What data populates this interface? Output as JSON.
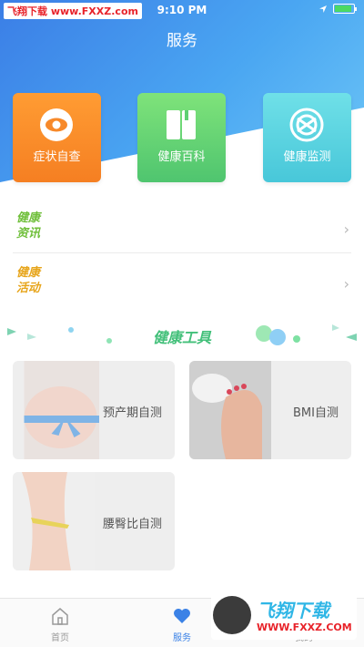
{
  "status_bar": {
    "watermark": "飞翔下载 www.FXXZ.com",
    "time": "9:10 PM"
  },
  "nav": {
    "title": "服务"
  },
  "service_cards": [
    {
      "label": "症状自查",
      "icon": "eye-icon",
      "color": "#f7892a"
    },
    {
      "label": "健康百科",
      "icon": "book-icon",
      "color": "#5fd073"
    },
    {
      "label": "健康监测",
      "icon": "monitor-icon",
      "color": "#55d0de"
    }
  ],
  "list_rows": [
    {
      "badge_line1": "健康",
      "badge_line2": "资讯",
      "badge_color": "#6fbf3a"
    },
    {
      "badge_line1": "健康",
      "badge_line2": "活动",
      "badge_color": "#e7a51c"
    }
  ],
  "tools_section": {
    "title": "健康工具"
  },
  "tools": [
    {
      "label": "预产期自测",
      "icon": "pregnancy-photo"
    },
    {
      "label": "BMI自测",
      "icon": "scale-photo"
    },
    {
      "label": "腰臀比自测",
      "icon": "waist-photo"
    }
  ],
  "tabbar": {
    "items": [
      {
        "label": "首页",
        "icon": "home-icon"
      },
      {
        "label": "服务",
        "icon": "heart-icon",
        "active": true
      },
      {
        "label": "我的",
        "icon": "user-icon"
      }
    ],
    "active_color": "#3b82e6"
  },
  "watermark_bottom": {
    "line1": "飞翔下载",
    "line2": "WWW.FXXZ.COM"
  }
}
